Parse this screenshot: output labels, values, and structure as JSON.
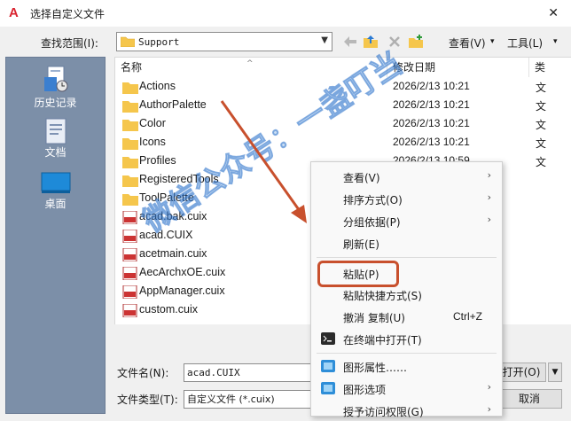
{
  "window": {
    "title": "选择自定义文件",
    "app_logo": "A"
  },
  "toolbar": {
    "lookin_label": "查找范围(I):",
    "lookin_value": "Support",
    "view_label": "查看(V)",
    "tools_label": "工具(L)",
    "icons": [
      "back-arrow-icon",
      "up-folder-icon",
      "delete-x-icon",
      "new-folder-icon"
    ]
  },
  "places": [
    {
      "label": "历史记录",
      "icon": "history-icon"
    },
    {
      "label": "文档",
      "icon": "documents-icon"
    },
    {
      "label": "桌面",
      "icon": "desktop-icon"
    }
  ],
  "columns": {
    "name": "名称",
    "date": "修改日期",
    "type": "类"
  },
  "files": [
    {
      "name": "Actions",
      "date": "2026/2/13 10:21",
      "type": "文",
      "kind": "folder"
    },
    {
      "name": "AuthorPalette",
      "date": "2026/2/13 10:21",
      "type": "文",
      "kind": "folder"
    },
    {
      "name": "Color",
      "date": "2026/2/13 10:21",
      "type": "文",
      "kind": "folder"
    },
    {
      "name": "Icons",
      "date": "2026/2/13 10:21",
      "type": "文",
      "kind": "folder"
    },
    {
      "name": "Profiles",
      "date": "2026/2/13 10:59",
      "type": "文",
      "kind": "folder"
    },
    {
      "name": "RegisteredTools",
      "date": "",
      "type": "",
      "kind": "folder"
    },
    {
      "name": "ToolPalette",
      "date": "",
      "type": "",
      "kind": "folder"
    },
    {
      "name": "acad.bak.cuix",
      "date": "",
      "type": "",
      "kind": "cuix"
    },
    {
      "name": "acad.CUIX",
      "date": "",
      "type": "",
      "kind": "cuix"
    },
    {
      "name": "acetmain.cuix",
      "date": "",
      "type": "",
      "kind": "cuix"
    },
    {
      "name": "AecArchxOE.cuix",
      "date": "",
      "type": "",
      "kind": "cuix"
    },
    {
      "name": "AppManager.cuix",
      "date": "",
      "type": "",
      "kind": "cuix"
    },
    {
      "name": "custom.cuix",
      "date": "",
      "type": "",
      "kind": "cuix"
    }
  ],
  "form": {
    "filename_label": "文件名(N):",
    "filename_value": "acad.CUIX",
    "filetype_label": "文件类型(T):",
    "filetype_value": "自定义文件 (*.cuix)",
    "open_label": "打开(O)",
    "cancel_label": "取消"
  },
  "context_menu": {
    "items": [
      {
        "label": "查看(V)",
        "submenu": true
      },
      {
        "label": "排序方式(O)",
        "submenu": true
      },
      {
        "label": "分组依据(P)",
        "submenu": true
      },
      {
        "label": "刷新(E)"
      },
      {
        "label": "粘贴(P)",
        "highlighted": true
      },
      {
        "label": "粘贴快捷方式(S)"
      },
      {
        "label": "撤消 复制(U)",
        "shortcut": "Ctrl+Z"
      },
      {
        "label": "在终端中打开(T)",
        "icon": "terminal-icon"
      },
      {
        "label": "图形属性……",
        "icon": "graphics-properties-icon"
      },
      {
        "label": "图形选项",
        "icon": "graphics-options-icon",
        "submenu": true
      },
      {
        "label": "授予访问权限(G)",
        "submenu": true
      }
    ]
  },
  "watermark": {
    "text": "微信公众号：一盏叮当"
  },
  "colors": {
    "annotation": "#c8502d",
    "places_bg": "#7c8fa8",
    "folder": "#f5c64c",
    "watermark": "#468cdc"
  }
}
